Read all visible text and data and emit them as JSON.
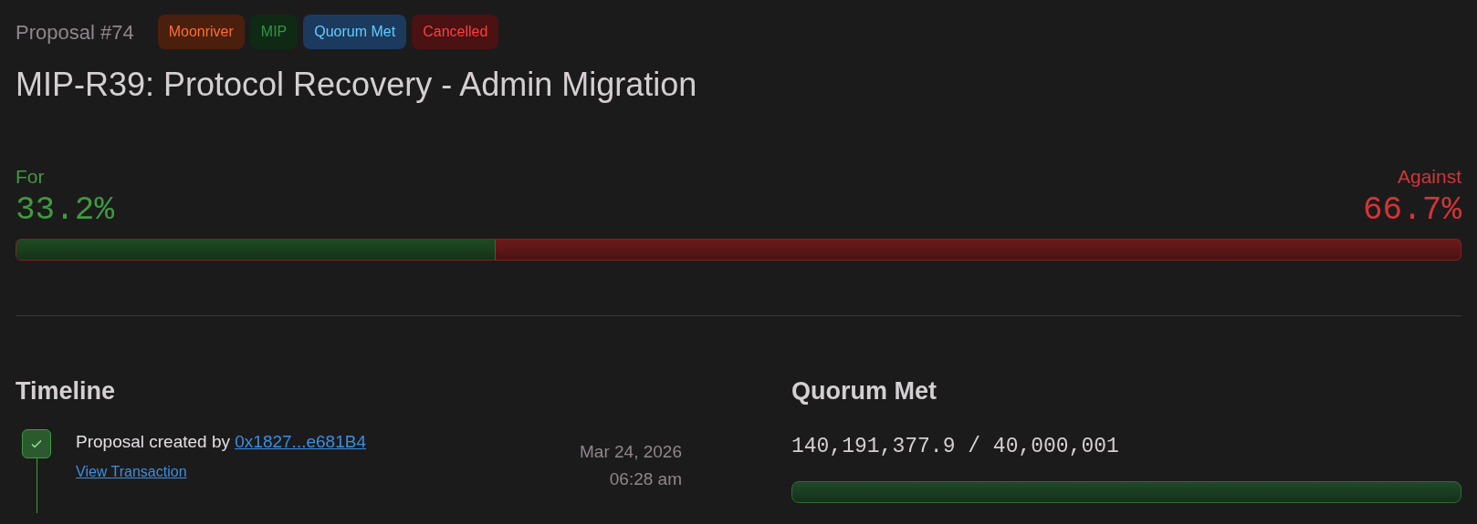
{
  "proposal_number": "Proposal #74",
  "badges": [
    {
      "label": "Moonriver",
      "color": "#4a1f0e"
    },
    {
      "label": "MIP",
      "color": "#0f2a14"
    },
    {
      "label": "Quorum Met",
      "color": "#1c3a5e"
    },
    {
      "label": "Cancelled",
      "color": "#4a1212"
    }
  ],
  "title": "MIP-R39: Protocol Recovery - Admin Migration",
  "votes": {
    "for_label": "For",
    "for_percent": "33.2%",
    "against_label": "Against",
    "against_percent": "66.7%",
    "level": 0.332
  },
  "timeline": {
    "heading": "Timeline",
    "events": [
      {
        "text": "Proposal created by",
        "address": "0x1827...e681B4",
        "link": "View Transaction",
        "date": "Mar 24, 2026",
        "time": "06:28 am",
        "done": true
      }
    ]
  },
  "quorum": {
    "heading": "Quorum Met",
    "reading": "140,191,377.9 / 40,000,001",
    "level": 1
  }
}
